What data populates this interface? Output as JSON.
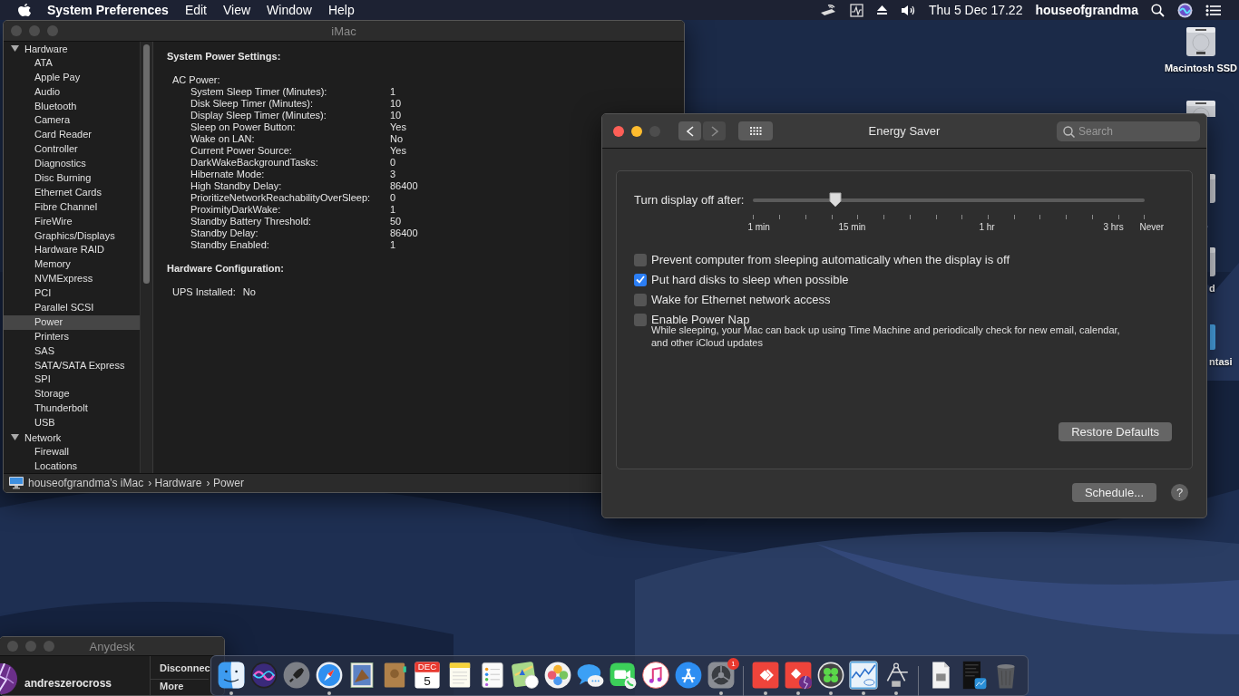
{
  "menu_bar": {
    "app": "System Preferences",
    "menus": [
      "Edit",
      "View",
      "Window",
      "Help"
    ],
    "clock": "Thu 5 Dec  17.22",
    "user": "houseofgrandma"
  },
  "desktop_icons": [
    {
      "kind": "drive",
      "label": "Macintosh SSD"
    },
    {
      "kind": "drive"
    },
    {
      "kind": "drive"
    },
    {
      "kind": "drive",
      "label": "d"
    },
    {
      "kind": "folder",
      "label": "ntasi"
    }
  ],
  "system_information": {
    "title": "iMac",
    "sidebar": [
      {
        "label": "Hardware",
        "expanded": true,
        "selected": false,
        "children": [
          {
            "label": "ATA",
            "selected": false
          },
          {
            "label": "Apple Pay",
            "selected": false
          },
          {
            "label": "Audio",
            "selected": false
          },
          {
            "label": "Bluetooth",
            "selected": false
          },
          {
            "label": "Camera",
            "selected": false
          },
          {
            "label": "Card Reader",
            "selected": false
          },
          {
            "label": "Controller",
            "selected": false
          },
          {
            "label": "Diagnostics",
            "selected": false
          },
          {
            "label": "Disc Burning",
            "selected": false
          },
          {
            "label": "Ethernet Cards",
            "selected": false
          },
          {
            "label": "Fibre Channel",
            "selected": false
          },
          {
            "label": "FireWire",
            "selected": false
          },
          {
            "label": "Graphics/Displays",
            "selected": false
          },
          {
            "label": "Hardware RAID",
            "selected": false
          },
          {
            "label": "Memory",
            "selected": false
          },
          {
            "label": "NVMExpress",
            "selected": false
          },
          {
            "label": "PCI",
            "selected": false
          },
          {
            "label": "Parallel SCSI",
            "selected": false
          },
          {
            "label": "Power",
            "selected": true
          },
          {
            "label": "Printers",
            "selected": false
          },
          {
            "label": "SAS",
            "selected": false
          },
          {
            "label": "SATA/SATA Express",
            "selected": false
          },
          {
            "label": "SPI",
            "selected": false
          },
          {
            "label": "Storage",
            "selected": false
          },
          {
            "label": "Thunderbolt",
            "selected": false
          },
          {
            "label": "USB",
            "selected": false
          }
        ]
      },
      {
        "label": "Network",
        "expanded": true,
        "selected": false,
        "children": [
          {
            "label": "Firewall",
            "selected": false
          },
          {
            "label": "Locations",
            "selected": false
          }
        ]
      }
    ],
    "content": [
      {
        "kind": "heading",
        "text": "System Power Settings:"
      },
      {
        "kind": "group",
        "title": "AC Power:",
        "rows": [
          {
            "key": "System Sleep Timer (Minutes):",
            "value": "1"
          },
          {
            "key": "Disk Sleep Timer (Minutes):",
            "value": "10"
          },
          {
            "key": "Display Sleep Timer (Minutes):",
            "value": "10"
          },
          {
            "key": "Sleep on Power Button:",
            "value": "Yes"
          },
          {
            "key": "Wake on LAN:",
            "value": "No"
          },
          {
            "key": "Current Power Source:",
            "value": "Yes"
          },
          {
            "key": "DarkWakeBackgroundTasks:",
            "value": "0"
          },
          {
            "key": "Hibernate Mode:",
            "value": "3"
          },
          {
            "key": "High Standby Delay:",
            "value": "86400"
          },
          {
            "key": "PrioritizeNetworkReachabilityOverSleep:",
            "value": "0"
          },
          {
            "key": "ProximityDarkWake:",
            "value": "1"
          },
          {
            "key": "Standby Battery Threshold:",
            "value": "50"
          },
          {
            "key": "Standby Delay:",
            "value": "86400"
          },
          {
            "key": "Standby Enabled:",
            "value": "1"
          }
        ]
      },
      {
        "kind": "heading",
        "text": "Hardware Configuration:"
      },
      {
        "kind": "inline",
        "key": "UPS Installed:",
        "value": "No"
      }
    ],
    "breadcrumb": [
      "houseofgrandma’s iMac",
      "› Hardware",
      "› Power"
    ]
  },
  "energy_saver": {
    "title": "Energy Saver",
    "nav": [
      {
        "disabled": false
      },
      {
        "disabled": true
      }
    ],
    "search": {
      "placeholder": "Search"
    },
    "slider": {
      "label": "Turn display off after:",
      "level": 0.21,
      "tick_labels": [
        "1 min",
        "15 min",
        "1 hr",
        "3 hrs",
        "Never"
      ]
    },
    "options": [
      {
        "label": "Prevent computer from sleeping automatically when the display is off",
        "checked": false
      },
      {
        "label": "Put hard disks to sleep when possible",
        "checked": true
      },
      {
        "label": "Wake for Ethernet network access",
        "checked": false
      },
      {
        "label": "Enable Power Nap",
        "checked": false,
        "description": "While sleeping, your Mac can back up using Time Machine and periodically check for new email, calendar, and other iCloud updates"
      }
    ],
    "buttons": [
      "Restore Defaults",
      "Schedule..."
    ],
    "help": "?"
  },
  "anydesk": {
    "title": "Anydesk",
    "user": "andreszerocross",
    "actions": [
      "Disconnec",
      "More"
    ]
  },
  "dock": [
    {
      "kind": "app",
      "running": true
    },
    {
      "kind": "app",
      "running": false
    },
    {
      "kind": "app",
      "running": false
    },
    {
      "kind": "app",
      "running": true
    },
    {
      "kind": "app",
      "running": false
    },
    {
      "kind": "app",
      "running": false
    },
    {
      "kind": "calendar",
      "running": false,
      "month": "DEC",
      "day": "5"
    },
    {
      "kind": "app",
      "running": false
    },
    {
      "kind": "app",
      "running": false
    },
    {
      "kind": "app",
      "running": false
    },
    {
      "kind": "app",
      "running": false
    },
    {
      "kind": "app",
      "running": false
    },
    {
      "kind": "app",
      "running": false
    },
    {
      "kind": "app",
      "running": false
    },
    {
      "kind": "app",
      "running": false
    },
    {
      "kind": "app",
      "running": true,
      "badge": "1"
    },
    {
      "kind": "separator"
    },
    {
      "kind": "app",
      "running": true
    },
    {
      "kind": "app",
      "running": true
    },
    {
      "kind": "app",
      "running": true
    },
    {
      "kind": "app",
      "running": true
    },
    {
      "kind": "app",
      "running": true
    },
    {
      "kind": "separator"
    },
    {
      "kind": "app",
      "running": false
    },
    {
      "kind": "app",
      "running": false
    },
    {
      "kind": "app",
      "running": false
    }
  ]
}
